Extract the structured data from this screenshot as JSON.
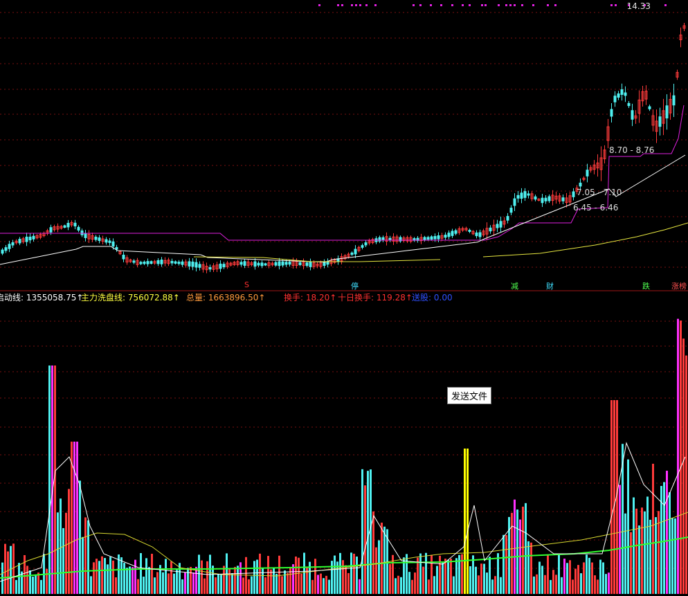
{
  "top_price_label": "14.33",
  "range_labels": [
    "8.70 - 8.76",
    "7.05 - 7.10",
    "6.45 - 6.46"
  ],
  "event_markers": [
    {
      "text": "S",
      "color": "#ff3030"
    },
    {
      "text": "停",
      "color": "#40e0ff"
    },
    {
      "text": "减",
      "color": "#50ff50"
    },
    {
      "text": "财",
      "color": "#40e0ff"
    },
    {
      "text": "跌",
      "color": "#50ff50"
    },
    {
      "text": "涨榜",
      "color": "#ff5050"
    }
  ],
  "indicators": [
    {
      "label": "启动线:",
      "value": "1355058.75↑",
      "color": "#ffffff"
    },
    {
      "label": "主力洗盘线:",
      "value": "756072.88↑",
      "color": "#ffff40"
    },
    {
      "label": "总量:",
      "value": "1663896.50↑",
      "color": "#ff9a3c"
    },
    {
      "label": "换手:",
      "value": "18.20↑",
      "color": "#ff3030"
    },
    {
      "label": "十日换手:",
      "value": "119.28↑",
      "color": "#ff3030"
    },
    {
      "label": "送股:",
      "value": "0.00",
      "color": "#3050ff"
    }
  ],
  "tooltip": "发送文件",
  "colors": {
    "up": "#ff3b3b",
    "down": "#4ff0f0",
    "grid": "#7a1010",
    "ma_white": "#ffffff",
    "ma_yellow": "#e8e840",
    "stop_magenta": "#e020e0",
    "vol_green": "#30ff30",
    "vol_yellow_line": "#d8d830"
  }
}
